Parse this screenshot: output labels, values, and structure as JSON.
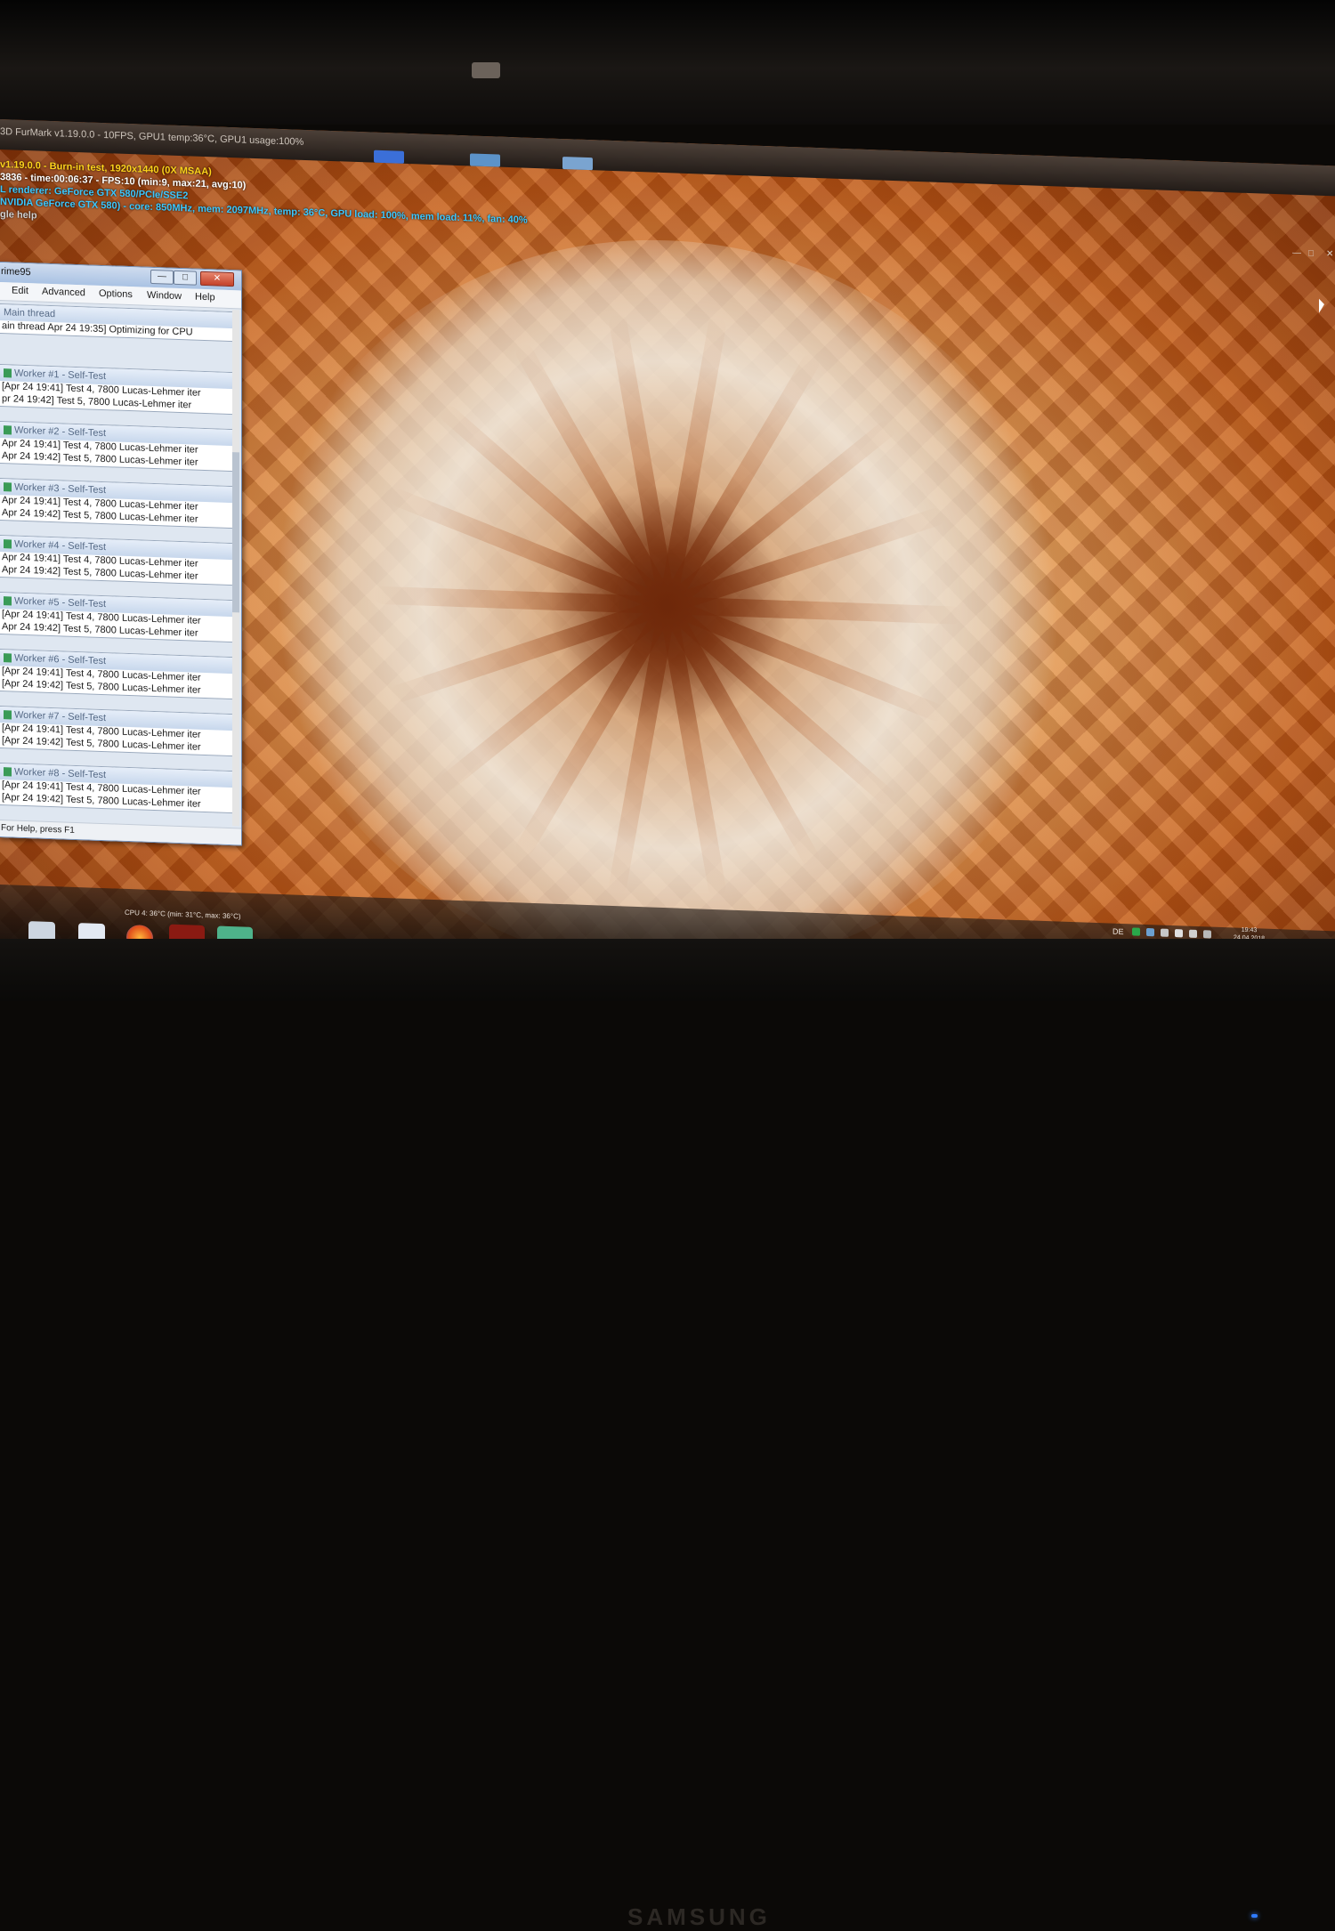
{
  "monitor": {
    "brand": "SAMSUNG"
  },
  "furmark": {
    "window_title": "3D FurMark v1.19.0.0 - 10FPS, GPU1 temp:36°C, GPU1 usage:100%",
    "overlay": [
      "v1.19.0.0 - Burn-in test, 1920x1440 (0X MSAA)",
      "3836 - time:00:06:37 - FPS:10 (min:9, max:21, avg:10)",
      "L renderer: GeForce GTX 580/PCIe/SSE2",
      "NVIDIA GeForce GTX 580) - core: 850MHz, mem: 2097MHz, temp: 36°C, GPU load: 100%, mem load: 11%, fan: 40%",
      "gle help"
    ]
  },
  "prime95": {
    "title": "rime95",
    "controls": [
      "—",
      "□",
      "✕"
    ],
    "menu": [
      "Edit",
      "Advanced",
      "Options",
      "Window",
      "Help"
    ],
    "main_thread": {
      "title": "Main thread",
      "lines": [
        "ain thread Apr 24 19:35] Optimizing for CPU"
      ]
    },
    "workers": [
      {
        "title": "Worker #1 - Self-Test",
        "lines": [
          "[Apr 24 19:41] Test 4, 7800 Lucas-Lehmer iter",
          "pr 24 19:42] Test 5, 7800 Lucas-Lehmer iter"
        ]
      },
      {
        "title": "Worker #2 - Self-Test",
        "lines": [
          "Apr 24 19:41] Test 4, 7800 Lucas-Lehmer iter",
          "Apr 24 19:42] Test 5, 7800 Lucas-Lehmer iter"
        ]
      },
      {
        "title": "Worker #3 - Self-Test",
        "lines": [
          "Apr 24 19:41] Test 4, 7800 Lucas-Lehmer iter",
          "Apr 24 19:42] Test 5, 7800 Lucas-Lehmer iter"
        ]
      },
      {
        "title": "Worker #4 - Self-Test",
        "lines": [
          "Apr 24 19:41] Test 4, 7800 Lucas-Lehmer iter",
          "Apr 24 19:42] Test 5, 7800 Lucas-Lehmer iter"
        ]
      },
      {
        "title": "Worker #5 - Self-Test",
        "lines": [
          "[Apr 24 19:41] Test 4, 7800 Lucas-Lehmer iter",
          "Apr 24 19:42] Test 5, 7800 Lucas-Lehmer iter"
        ]
      },
      {
        "title": "Worker #6 - Self-Test",
        "lines": [
          "[Apr 24 19:41] Test 4, 7800 Lucas-Lehmer iter",
          "[Apr 24 19:42] Test 5, 7800 Lucas-Lehmer iter"
        ]
      },
      {
        "title": "Worker #7 - Self-Test",
        "lines": [
          "[Apr 24 19:41] Test 4, 7800 Lucas-Lehmer iter",
          "[Apr 24 19:42] Test 5, 7800 Lucas-Lehmer iter"
        ]
      },
      {
        "title": "Worker #8 - Self-Test",
        "lines": [
          "[Apr 24 19:41] Test 4, 7800 Lucas-Lehmer iter",
          "[Apr 24 19:42] Test 5, 7800 Lucas-Lehmer iter"
        ]
      }
    ],
    "status": "For Help, press F1"
  },
  "taskbar": {
    "cpu_temp": "CPU 4: 36°C (min: 31°C, max: 36°C)",
    "language": "DE",
    "clock_time": "19:43",
    "clock_date": "24.04.2018",
    "icons": [
      "windows-explorer-icon",
      "media-player-icon",
      "firefox-icon",
      "furmark-icon",
      "prime95-icon"
    ]
  }
}
